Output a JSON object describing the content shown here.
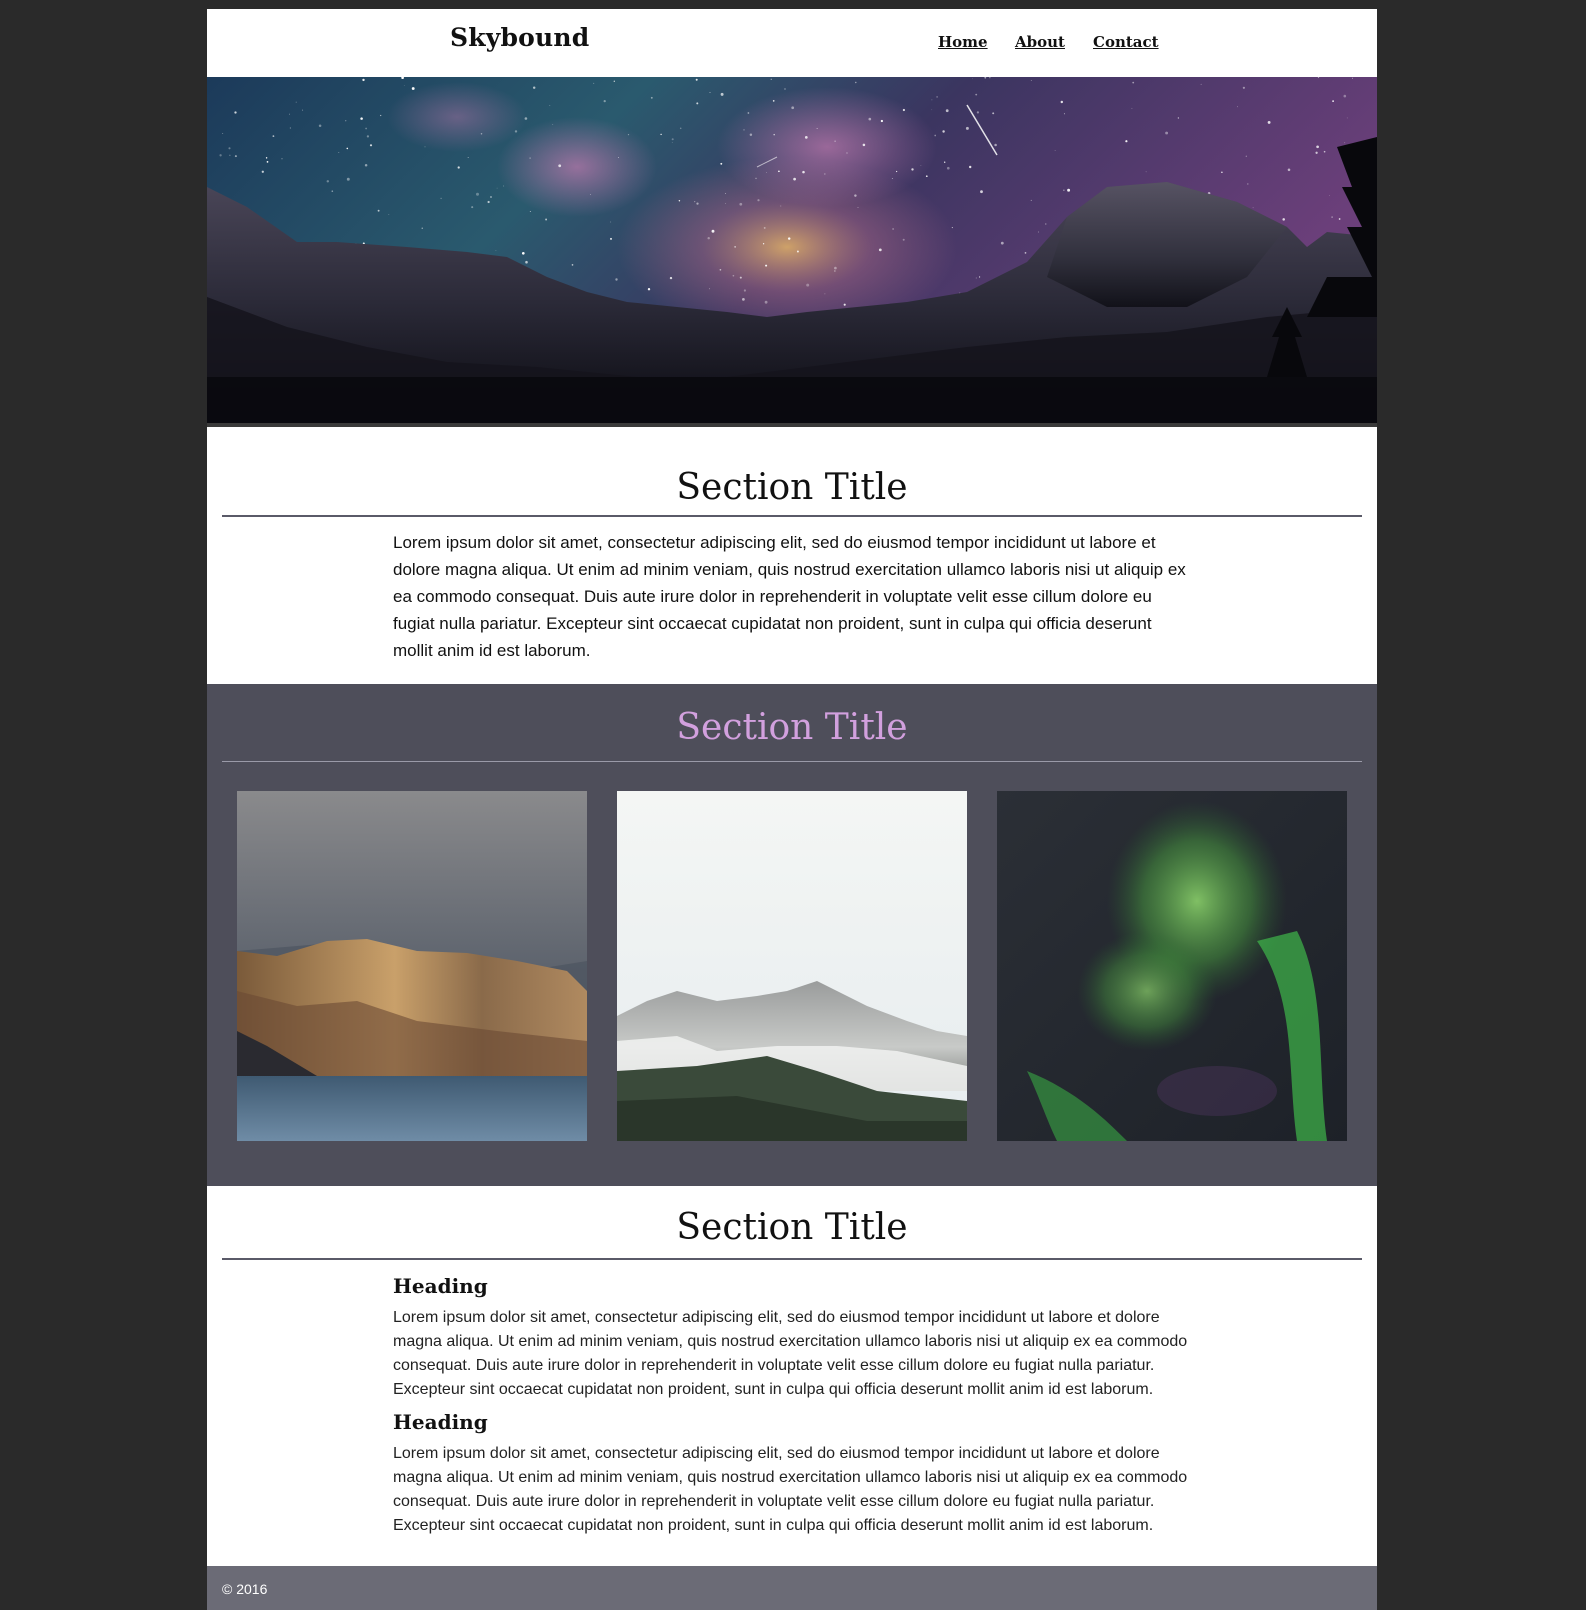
{
  "header": {
    "logo": "Skybound",
    "nav": [
      {
        "label": "Home"
      },
      {
        "label": "About"
      },
      {
        "label": "Contact"
      }
    ]
  },
  "section1": {
    "title": "Section Title",
    "text": "Lorem ipsum dolor sit amet, consectetur adipiscing elit, sed do eiusmod tempor incididunt ut labore et dolore magna aliqua. Ut enim ad minim veniam, quis nostrud exercitation ullamco laboris nisi ut aliquip ex ea commodo consequat. Duis aute irure dolor in reprehenderit in voluptate velit esse cillum dolore eu fugiat nulla pariatur. Excepteur sint occaecat cupidatat non proident, sunt in culpa qui officia deserunt mollit anim id est laborum."
  },
  "section2": {
    "title": "Section Title",
    "title_color": "#d2a0de",
    "gallery": [
      {
        "subject": "mountain-lake-photo"
      },
      {
        "subject": "snowy-mountain-photo"
      },
      {
        "subject": "aurora-photo"
      }
    ]
  },
  "section3": {
    "title": "Section Title",
    "articles": [
      {
        "heading": "Heading",
        "text": "Lorem ipsum dolor sit amet, consectetur adipiscing elit, sed do eiusmod tempor incididunt ut labore et dolore magna aliqua. Ut enim ad minim veniam, quis nostrud exercitation ullamco laboris nisi ut aliquip ex ea commodo consequat. Duis aute irure dolor in reprehenderit in voluptate velit esse cillum dolore eu fugiat nulla pariatur. Excepteur sint occaecat cupidatat non proident, sunt in culpa qui officia deserunt mollit anim id est laborum."
      },
      {
        "heading": "Heading",
        "text": "Lorem ipsum dolor sit amet, consectetur adipiscing elit, sed do eiusmod tempor incididunt ut labore et dolore magna aliqua. Ut enim ad minim veniam, quis nostrud exercitation ullamco laboris nisi ut aliquip ex ea commodo consequat. Duis aute irure dolor in reprehenderit in voluptate velit esse cillum dolore eu fugiat nulla pariatur. Excepteur sint occaecat cupidatat non proident, sunt in culpa qui officia deserunt mollit anim id est laborum."
      }
    ]
  },
  "footer": {
    "copyright": "© 2016"
  },
  "colors": {
    "outer_background": "#2a2a2a",
    "gallery_background": "#4e4e5a",
    "footer_background": "#6b6b76"
  }
}
